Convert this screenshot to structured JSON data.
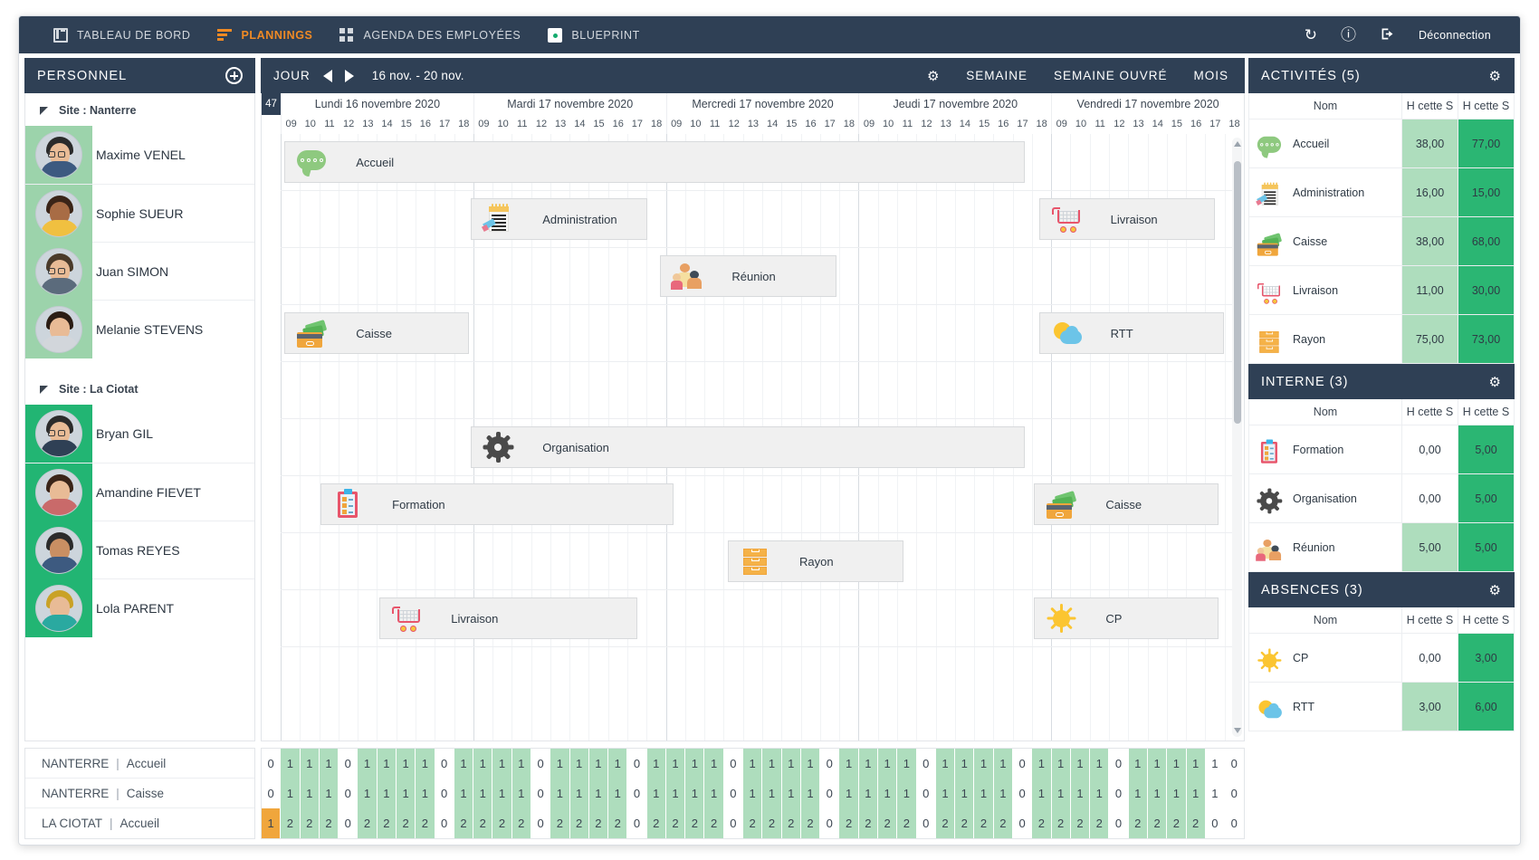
{
  "topnav": {
    "items": [
      {
        "label": "TABLEAU DE BORD",
        "icon": "dashboard-icon",
        "active": false
      },
      {
        "label": "PLANNINGS",
        "icon": "bars-icon",
        "active": true
      },
      {
        "label": "AGENDA DES EMPLOYÉES",
        "icon": "grid-icon",
        "active": false
      },
      {
        "label": "BLUEPRINT",
        "icon": "blueprint-icon",
        "active": false
      }
    ],
    "refresh_icon": "↻",
    "info_icon": "ⓘ",
    "logout_icon": "→]",
    "logout_label": "Déconnection",
    "accent_color": "#f08a24",
    "bar_color": "#2f4055"
  },
  "personnel": {
    "title": "PERSONNEL",
    "add_label": "+",
    "groups": [
      {
        "site_label": "Site : Nanterre",
        "employees": [
          {
            "name": "Maxime VENEL",
            "avatar_bg": "#9cd3ab",
            "hair": "#2b2b2b",
            "shirt": "#3d5a80"
          },
          {
            "name": "Sophie SUEUR",
            "avatar_bg": "#9cd3ab",
            "hair": "#3a2418",
            "shirt": "#f0c040"
          },
          {
            "name": "Juan SIMON",
            "avatar_bg": "#9cd3ab",
            "hair": "#4a3a2a",
            "shirt": "#5b6b7c"
          },
          {
            "name": "Melanie STEVENS",
            "avatar_bg": "#9cd3ab",
            "hair": "#2b1d14",
            "shirt": "#d2d6db"
          }
        ]
      },
      {
        "site_label": "Site : La Ciotat",
        "employees": [
          {
            "name": "Bryan GIL",
            "avatar_bg": "#22b573",
            "hair": "#2b2b2b",
            "shirt": "#2f4055"
          },
          {
            "name": "Amandine FIEVET",
            "avatar_bg": "#22b573",
            "hair": "#3a2418",
            "shirt": "#c96a6a"
          },
          {
            "name": "Tomas REYES",
            "avatar_bg": "#22b573",
            "hair": "#2b2b2b",
            "shirt": "#3d5a80"
          },
          {
            "name": "Lola PARENT",
            "avatar_bg": "#22b573",
            "hair": "#c9a227",
            "shirt": "#2aa9a0"
          }
        ]
      }
    ],
    "footer_rows": [
      {
        "site": "NANTERRE",
        "sep": "|",
        "activity": "Accueil"
      },
      {
        "site": "NANTERRE",
        "sep": "|",
        "activity": "Caisse"
      },
      {
        "site": "LA CIOTAT",
        "sep": "|",
        "activity": "Accueil"
      }
    ]
  },
  "toolbar": {
    "jour_label": "JOUR",
    "prev_label": "◀",
    "next_label": "▶",
    "date_range": "16 nov. - 20 nov.",
    "gear_icon": "⚙",
    "semaine_label": "SEMAINE",
    "semaine_ouvre_label": "SEMAINE OUVRÉ",
    "mois_label": "MOIS"
  },
  "calendar": {
    "week_number": "47",
    "days": [
      "Lundi 16 novembre 2020",
      "Mardi 17 novembre 2020",
      "Mercredi 17 novembre 2020",
      "Jeudi 17 novembre 2020",
      "Vendredi 17 novembre 2020"
    ],
    "hours": [
      "09",
      "10",
      "11",
      "12",
      "13",
      "14",
      "15",
      "16",
      "17",
      "18"
    ],
    "tasks": [
      {
        "label": "Accueil",
        "icon": "accueil-icon",
        "row": 0,
        "start_pct": 0.4,
        "width_pct": 77.8
      },
      {
        "label": "Administration",
        "icon": "administration-icon",
        "row": 1,
        "start_pct": 20.0,
        "width_pct": 18.5
      },
      {
        "label": "Livraison",
        "icon": "livraison-icon",
        "row": 1,
        "start_pct": 79.7,
        "width_pct": 18.5
      },
      {
        "label": "Réunion",
        "icon": "reunion-icon",
        "row": 2,
        "start_pct": 39.9,
        "width_pct": 18.5
      },
      {
        "label": "Caisse",
        "icon": "caisse-icon",
        "row": 3,
        "start_pct": 0.4,
        "width_pct": 19.4
      },
      {
        "label": "RTT",
        "icon": "rtt-icon",
        "row": 3,
        "start_pct": 79.7,
        "width_pct": 19.4
      },
      {
        "label": "Organisation",
        "icon": "organisation-icon",
        "row": 5,
        "start_pct": 20.0,
        "width_pct": 58.2
      },
      {
        "label": "Formation",
        "icon": "formation-icon",
        "row": 6,
        "start_pct": 4.2,
        "width_pct": 37.1
      },
      {
        "label": "Caisse",
        "icon": "caisse-icon",
        "row": 6,
        "start_pct": 79.2,
        "width_pct": 19.4
      },
      {
        "label": "Rayon",
        "icon": "rayon-icon",
        "row": 7,
        "start_pct": 47.0,
        "width_pct": 18.5
      },
      {
        "label": "Livraison",
        "icon": "livraison-icon",
        "row": 8,
        "start_pct": 10.4,
        "width_pct": 27.1
      },
      {
        "label": "CP",
        "icon": "cp-icon",
        "row": 8,
        "start_pct": 79.2,
        "width_pct": 19.4
      }
    ]
  },
  "footer_grid": {
    "rows": [
      {
        "values": [
          "0",
          "1",
          "1",
          "1",
          "0",
          "1",
          "1",
          "1",
          "1",
          "0",
          "1",
          "1",
          "1",
          "1",
          "0",
          "1",
          "1",
          "1",
          "1",
          "0",
          "1",
          "1",
          "1",
          "1",
          "0",
          "1",
          "1",
          "1",
          "1",
          "0",
          "1",
          "1",
          "1",
          "1",
          "0",
          "1",
          "1",
          "1",
          "1",
          "0",
          "1",
          "1",
          "1",
          "1",
          "0",
          "1",
          "1",
          "1",
          "1",
          "1",
          "0"
        ],
        "fills": [
          "w",
          "g",
          "g",
          "g",
          "w",
          "g",
          "g",
          "g",
          "g",
          "w",
          "g",
          "g",
          "g",
          "g",
          "w",
          "g",
          "g",
          "g",
          "g",
          "w",
          "g",
          "g",
          "g",
          "g",
          "w",
          "g",
          "g",
          "g",
          "g",
          "w",
          "g",
          "g",
          "g",
          "g",
          "w",
          "g",
          "g",
          "g",
          "g",
          "w",
          "g",
          "g",
          "g",
          "g",
          "w",
          "g",
          "g",
          "g",
          "g",
          "w",
          "w"
        ]
      },
      {
        "values": [
          "0",
          "1",
          "1",
          "1",
          "0",
          "1",
          "1",
          "1",
          "1",
          "0",
          "1",
          "1",
          "1",
          "1",
          "0",
          "1",
          "1",
          "1",
          "1",
          "0",
          "1",
          "1",
          "1",
          "1",
          "0",
          "1",
          "1",
          "1",
          "1",
          "0",
          "1",
          "1",
          "1",
          "1",
          "0",
          "1",
          "1",
          "1",
          "1",
          "0",
          "1",
          "1",
          "1",
          "1",
          "0",
          "1",
          "1",
          "1",
          "1",
          "1",
          "0"
        ],
        "fills": [
          "w",
          "g",
          "g",
          "g",
          "w",
          "g",
          "g",
          "g",
          "g",
          "w",
          "g",
          "g",
          "g",
          "g",
          "w",
          "g",
          "g",
          "g",
          "g",
          "w",
          "g",
          "g",
          "g",
          "g",
          "w",
          "g",
          "g",
          "g",
          "g",
          "w",
          "g",
          "g",
          "g",
          "g",
          "w",
          "g",
          "g",
          "g",
          "g",
          "w",
          "g",
          "g",
          "g",
          "g",
          "w",
          "g",
          "g",
          "g",
          "g",
          "w",
          "w"
        ]
      },
      {
        "values": [
          "1",
          "2",
          "2",
          "2",
          "0",
          "2",
          "2",
          "2",
          "2",
          "0",
          "2",
          "2",
          "2",
          "2",
          "0",
          "2",
          "2",
          "2",
          "2",
          "0",
          "2",
          "2",
          "2",
          "2",
          "0",
          "2",
          "2",
          "2",
          "2",
          "0",
          "2",
          "2",
          "2",
          "2",
          "0",
          "2",
          "2",
          "2",
          "2",
          "0",
          "2",
          "2",
          "2",
          "2",
          "0",
          "2",
          "2",
          "2",
          "2",
          "0",
          "0"
        ],
        "fills": [
          "o",
          "g",
          "g",
          "g",
          "w",
          "g",
          "g",
          "g",
          "g",
          "w",
          "g",
          "g",
          "g",
          "g",
          "w",
          "g",
          "g",
          "g",
          "g",
          "w",
          "g",
          "g",
          "g",
          "g",
          "w",
          "g",
          "g",
          "g",
          "g",
          "w",
          "g",
          "g",
          "g",
          "g",
          "w",
          "g",
          "g",
          "g",
          "g",
          "w",
          "g",
          "g",
          "g",
          "g",
          "w",
          "g",
          "g",
          "g",
          "g",
          "w",
          "w"
        ]
      }
    ]
  },
  "stats": {
    "columns": [
      "Nom",
      "H cette S",
      "H cette S"
    ],
    "panels": [
      {
        "title": "ACTIVITÉS (5)",
        "gear_icon": "⚙",
        "rows": [
          {
            "name": "Accueil",
            "icon": "accueil-icon",
            "v1": "38,00",
            "v2": "77,00"
          },
          {
            "name": "Administration",
            "icon": "administration-icon",
            "v1": "16,00",
            "v2": "15,00"
          },
          {
            "name": "Caisse",
            "icon": "caisse-icon",
            "v1": "38,00",
            "v2": "68,00"
          },
          {
            "name": "Livraison",
            "icon": "livraison-icon",
            "v1": "11,00",
            "v2": "30,00"
          },
          {
            "name": "Rayon",
            "icon": "rayon-icon",
            "v1": "75,00",
            "v2": "73,00"
          }
        ]
      },
      {
        "title": "INTERNE (3)",
        "gear_icon": "⚙",
        "rows": [
          {
            "name": "Formation",
            "icon": "formation-icon",
            "v1": "0,00",
            "v2": "5,00",
            "v1_fill": "white"
          },
          {
            "name": "Organisation",
            "icon": "organisation-icon",
            "v1": "0,00",
            "v2": "5,00",
            "v1_fill": "white"
          },
          {
            "name": "Réunion",
            "icon": "reunion-icon",
            "v1": "5,00",
            "v2": "5,00"
          }
        ]
      },
      {
        "title": "ABSENCES (3)",
        "gear_icon": "⚙",
        "rows": [
          {
            "name": "CP",
            "icon": "cp-icon",
            "v1": "0,00",
            "v2": "3,00",
            "v1_fill": "white"
          },
          {
            "name": "RTT",
            "icon": "rtt-icon",
            "v1": "3,00",
            "v2": "6,00"
          }
        ]
      }
    ],
    "colors": {
      "light_green": "#aeddbd",
      "dark_green": "#2bb673",
      "header": "#2f4055"
    }
  }
}
